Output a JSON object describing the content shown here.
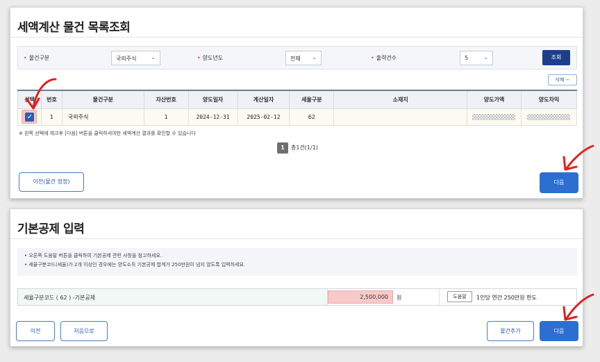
{
  "card1": {
    "title": "세액계산 물건 목록조회",
    "search": {
      "field1_label": "물건구분",
      "field1_value": "국외주식",
      "field2_label": "양도년도",
      "field2_value": "전체",
      "field3_label": "출력건수",
      "field3_value": "5",
      "query_button": "조회"
    },
    "delete_button": "삭제 −",
    "table": {
      "headers": [
        "선택",
        "번호",
        "물건구분",
        "자산번호",
        "양도일자",
        "계산일자",
        "세율구분",
        "소재지",
        "양도가액",
        "양도차익"
      ],
      "row": {
        "no": "1",
        "category": "국외주식",
        "asset_no": "1",
        "transfer_date": "2024-12-31",
        "calc_date": "2025-02-12",
        "tax_code": "62",
        "location": ""
      }
    },
    "note": "※ 왼쪽 선택에 체크후 [다음] 버튼을 클릭하셔야만 세액계산 결과를 확인할 수 있습니다",
    "pager": {
      "page": "1",
      "summary": "총1건(1/1)"
    },
    "prev_button": "이전(물건 정정)",
    "next_button": "다음"
  },
  "card2": {
    "title": "기본공제 입력",
    "info_line1": "• 오른쪽 도움말 버튼을 클릭하여 기본공제 관련 사항을 참고하세요.",
    "info_line2": "• 세율구분코드(세율)가 2개 이상인 경우에는 양도소득 기본공제 합계가 250만원이 넘지 않도록 입력하세요.",
    "deduction": {
      "label": "세율구분코드 ( 62 ) -기본공제",
      "amount": "2,500,000",
      "unit": "원",
      "help_button": "도움말",
      "limit_text": "1인당 연간 250만원 한도"
    },
    "prev_button": "이전",
    "first_button": "처음으로",
    "add_button": "물건추가",
    "next_button": "다음"
  },
  "colors": {
    "primary": "#2c6fd1",
    "dark_navy": "#1b3f8a",
    "highlight_red": "#f6c5c5",
    "annotation_red": "#e02020"
  },
  "icons": [
    "check-icon",
    "chevron-down-icon",
    "annotation-arrow-icon"
  ]
}
